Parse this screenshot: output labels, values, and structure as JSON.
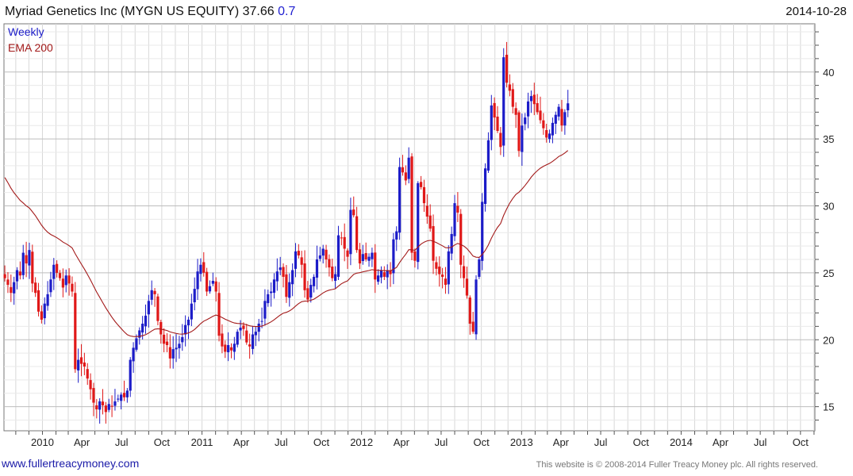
{
  "header": {
    "title": "Myriad Genetics Inc (MYGN US EQUITY) 37.66",
    "change": "0.7",
    "date": "2014-10-28"
  },
  "footer": {
    "link": "www.fullertreacymoney.com",
    "copyright": "This website is © 2008-2014 Fuller Treacy Money plc. All rights reserved."
  },
  "colors": {
    "up": "#1c1cc8",
    "down": "#e01818",
    "ema": "#a31a1a",
    "grid": "#d8d8d8"
  },
  "chart_data": {
    "type": "candlestick",
    "title": "Myriad Genetics Inc (MYGN US EQUITY) 37.66 0.7",
    "legend": [
      {
        "label": "Weekly",
        "color": "#1c1cc8"
      },
      {
        "label": "EMA 200",
        "color": "#a31a1a"
      }
    ],
    "legend_position": "top-left",
    "y_axis": {
      "position": "right",
      "ticks": [
        15,
        20,
        25,
        30,
        35,
        40
      ],
      "ylim": [
        13.2,
        43.6
      ]
    },
    "x_axis": {
      "ticks": [
        "2010",
        "Apr",
        "Jul",
        "Oct",
        "2011",
        "Apr",
        "Jul",
        "Oct",
        "2012",
        "Apr",
        "Jul",
        "Oct",
        "2013",
        "Apr",
        "Jul",
        "Oct",
        "2014",
        "Apr",
        "Jul",
        "Oct"
      ],
      "range": [
        "2009-10-05",
        "2014-11-03"
      ]
    },
    "grid": true,
    "start_date": "2009-10-05",
    "interval": "weekly",
    "closes": [
      24.6,
      24.1,
      23.5,
      24.3,
      25.2,
      24.8,
      26.5,
      25.7,
      26.7,
      24.2,
      23.5,
      22.1,
      21.5,
      22.7,
      23.4,
      24.5,
      25.6,
      25.0,
      24.6,
      23.9,
      24.8,
      24.2,
      23.6,
      17.8,
      18.5,
      18.2,
      18.0,
      17.1,
      16.3,
      15.3,
      14.8,
      15.4,
      15.1,
      14.6,
      15.2,
      15.0,
      15.4,
      15.6,
      15.9,
      15.7,
      16.2,
      18.5,
      19.4,
      20.1,
      20.7,
      21.2,
      21.8,
      22.9,
      23.7,
      23.4,
      21.4,
      20.4,
      19.7,
      19.6,
      18.6,
      19.3,
      19.4,
      19.7,
      20.2,
      21.1,
      21.5,
      22.7,
      23.8,
      25.1,
      25.6,
      25.0,
      23.6,
      24.0,
      24.4,
      23.6,
      20.3,
      19.5,
      19.1,
      19.6,
      19.2,
      19.7,
      20.6,
      20.9,
      20.8,
      19.8,
      19.5,
      20.4,
      20.6,
      21.2,
      21.4,
      22.9,
      23.4,
      23.6,
      24.5,
      25.1,
      25.4,
      24.7,
      23.2,
      24.3,
      25.2,
      26.6,
      26.3,
      25.6,
      23.7,
      23.0,
      24.1,
      24.7,
      26.0,
      26.3,
      26.8,
      26.0,
      25.4,
      24.6,
      24.9,
      27.8,
      27.6,
      26.8,
      26.2,
      29.7,
      29.3,
      26.7,
      25.7,
      26.4,
      26.0,
      26.2,
      26.5,
      24.5,
      24.8,
      25.2,
      24.7,
      25.2,
      24.9,
      27.5,
      28.1,
      32.9,
      32.5,
      31.9,
      33.6,
      26.5,
      25.9,
      31.7,
      31.4,
      30.2,
      29.2,
      28.3,
      25.9,
      25.3,
      24.9,
      24.7,
      24.1,
      26.6,
      27.9,
      30.2,
      29.5,
      25.6,
      24.6,
      23.3,
      21.2,
      20.6,
      24.5,
      26.0,
      30.3,
      32.8,
      34.9,
      37.5,
      36.6,
      35.6,
      34.4,
      41.1,
      39.2,
      38.6,
      37.4,
      36.8,
      34.1,
      36.0,
      36.6,
      37.8,
      38.2,
      37.6,
      37.0,
      36.4,
      35.8,
      35.1,
      35.4,
      36.2,
      36.8,
      37.4,
      36.0,
      37.0,
      37.66
    ],
    "ema200_last": 35.3
  }
}
